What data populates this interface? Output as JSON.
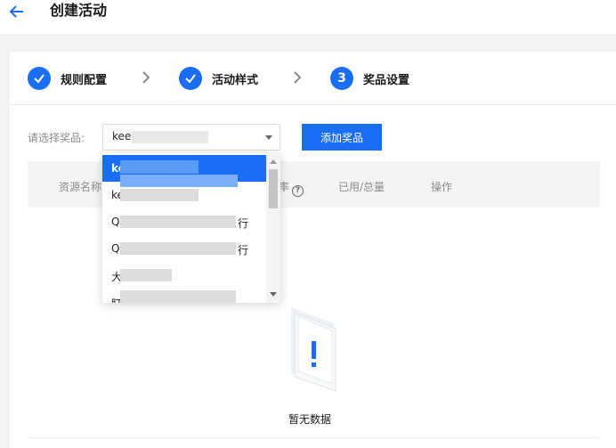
{
  "header": {
    "back_icon": "arrow-left-icon",
    "title": "创建活动"
  },
  "steps": [
    {
      "indicator": "check",
      "label": "规则配置",
      "status": "done"
    },
    {
      "indicator": "check",
      "label": "活动样式",
      "status": "done"
    },
    {
      "indicator": "3",
      "label": "奖品设置",
      "status": "current"
    }
  ],
  "prize_row": {
    "label": "请选择奖品:",
    "selected_value": "kee",
    "add_button": "添加奖品"
  },
  "table": {
    "columns": [
      "资源名称",
      "率",
      "已用/总量",
      "操作"
    ]
  },
  "dropdown": {
    "options": [
      {
        "text": "ke",
        "selected": true
      },
      {
        "text": "ke",
        "selected": false
      },
      {
        "text": "Q",
        "suffix": "行",
        "selected": false
      },
      {
        "text": "Q",
        "suffix": "行",
        "selected": false
      },
      {
        "text": "大",
        "selected": false
      },
      {
        "text": "盯",
        "selected": false
      }
    ]
  },
  "empty": {
    "icon": "empty-box-icon",
    "text": "暂无数据"
  },
  "colors": {
    "accent": "#1a6ef5",
    "page_bg": "#f2f3f5",
    "table_head_bg": "#f3f4f6"
  }
}
